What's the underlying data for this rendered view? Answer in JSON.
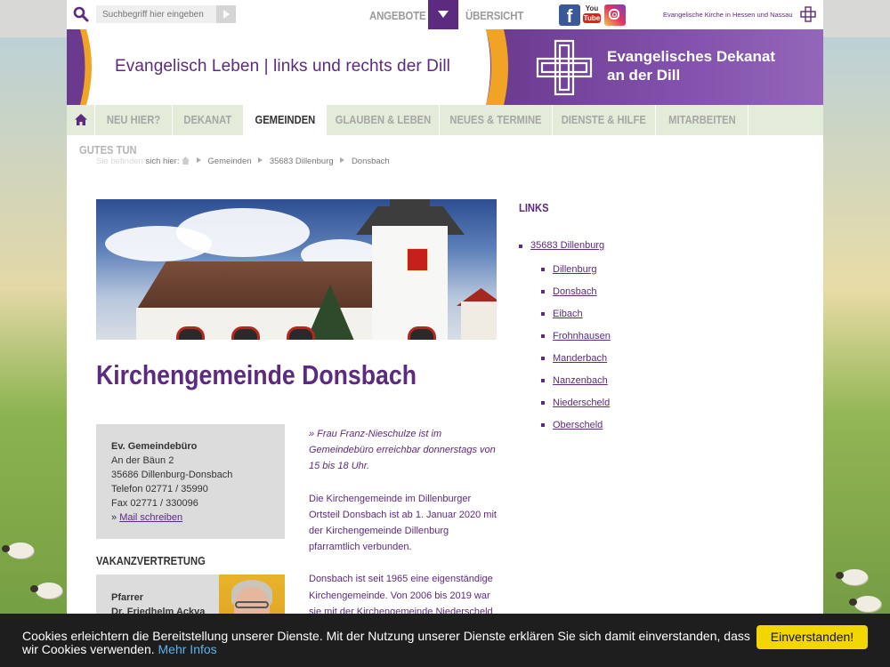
{
  "colors": {
    "brand_purple": "#5c2a7e",
    "nav_bg": "#e2ecd9",
    "cookie_bg": "#1e1e1e",
    "cookie_button": "#f1d600"
  },
  "topbar": {
    "search_placeholder": "Suchbegriff hier eingeben",
    "angebote": "ANGEBOTE",
    "uebersicht": "ÜBERSICHT",
    "youtube_you": "You",
    "youtube_tube": "Tube",
    "facebook": "f",
    "ekhn": "Evangelische Kirche in Hessen und Nassau"
  },
  "banner": {
    "tagline": "Evangelisch Leben | links und rechts der Dill",
    "title_line1": "Evangelisches Dekanat",
    "title_line2": "an der Dill"
  },
  "nav": {
    "items": [
      {
        "label": "NEU HIER?"
      },
      {
        "label": "DEKANAT"
      },
      {
        "label": "GEMEINDEN"
      },
      {
        "label": "GLAUBEN & LEBEN"
      },
      {
        "label": "NEUES & TERMINE"
      },
      {
        "label": "DIENSTE & HILFE"
      },
      {
        "label": "MITARBEITEN"
      }
    ],
    "second_row": "GUTES TUN"
  },
  "breadcrumb": {
    "prefix_faded": "Sie befinden",
    "prefix": "sich hier:",
    "items": [
      "Gemeinden",
      "35683 Dillenburg",
      "Donsbach"
    ]
  },
  "page": {
    "title": "Kirchengemeinde Donsbach"
  },
  "infobox": {
    "title": "Ev. Gemeindebüro",
    "street": "An der Bäun 2",
    "city": "35686 Dillenburg-Donsbach",
    "phone": "Telefon 02771 / 35990",
    "fax": "Fax 02771 / 330096",
    "mail_prefix": "»",
    "mail_link": "Mail schreiben"
  },
  "vakanz": {
    "title": "VAKANZVERTRETUNG",
    "role": "Pfarrer",
    "name": "Dr. Friedhelm Ackva"
  },
  "text": {
    "lead": "» Frau Franz-Nieschulze ist im Gemeindebüro erreichbar donnerstags von 15 bis 18 Uhr.",
    "p1": "Die Kirchengemeinde im Dillenburger Ortsteil Donsbach ist ab 1. Januar 2020 mit der Kirchengemeinde Dillenburg pfarramtlich verbunden.",
    "p2": "Donsbach ist seit 1965 eine eigenständige Kirchengemeinde. Von 2006 bis 2019 war sie mit der Kirchengemeinde Niederscheld"
  },
  "links": {
    "title": "LINKS",
    "parent": "35683 Dillenburg",
    "children": [
      "Dillenburg",
      "Donsbach",
      "Eibach",
      "Frohnhausen",
      "Manderbach",
      "Nanzenbach",
      "Niederscheld",
      "Oberscheld"
    ]
  },
  "cookie": {
    "text": "Cookies erleichtern die Bereitstellung unserer Dienste. Mit der Nutzung unserer Dienste erklären Sie sich damit einverstanden, dass wir Cookies verwenden.",
    "more": "Mehr Infos",
    "button": "Einverstanden!"
  }
}
